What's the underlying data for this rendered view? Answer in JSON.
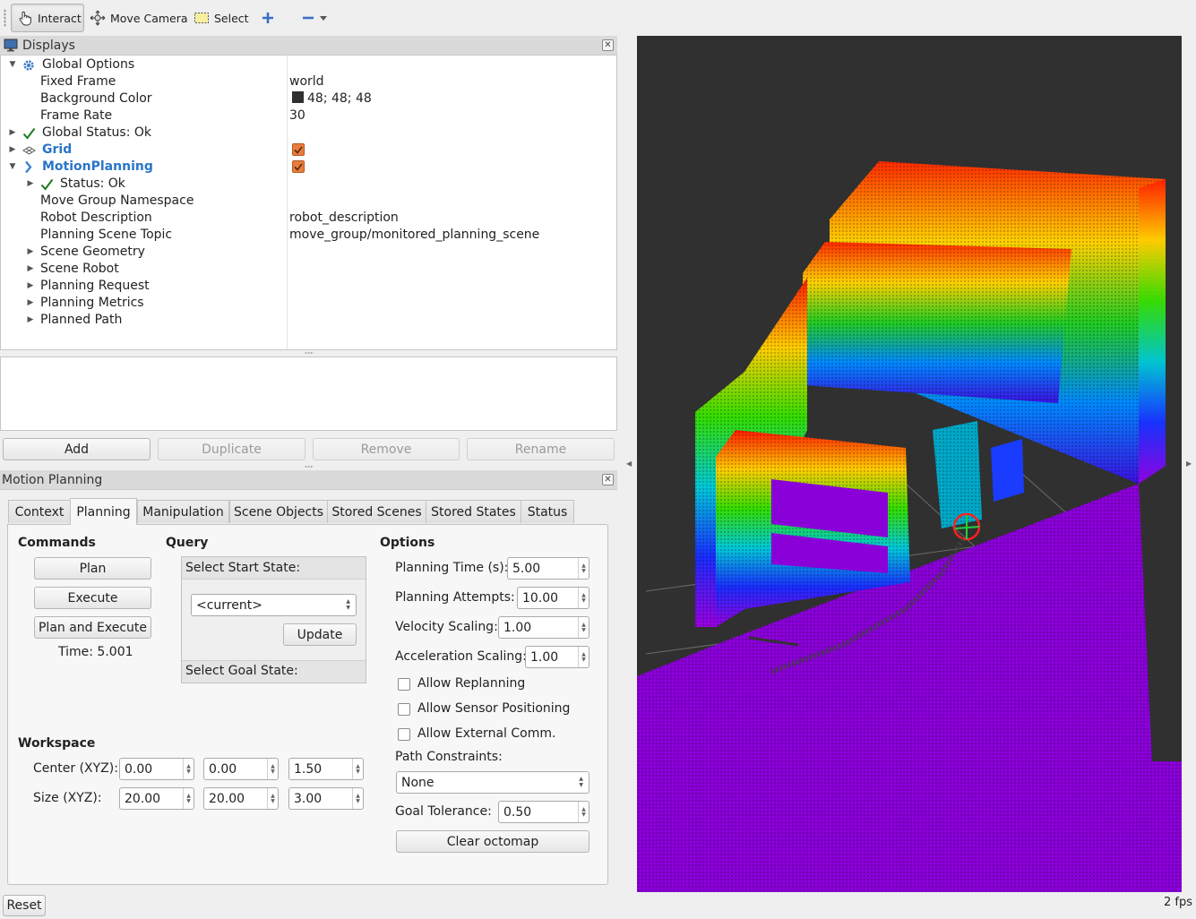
{
  "toolbar": {
    "interact": "Interact",
    "move_camera": "Move Camera",
    "select": "Select"
  },
  "displays_panel": {
    "title": "Displays",
    "rows": [
      {
        "label": "Global Options",
        "value": ""
      },
      {
        "label": "Fixed Frame",
        "value": "world"
      },
      {
        "label": "Background Color",
        "value": "48; 48; 48"
      },
      {
        "label": "Frame Rate",
        "value": "30"
      },
      {
        "label": "Global Status: Ok",
        "value": ""
      },
      {
        "label": "Grid",
        "value": ""
      },
      {
        "label": "MotionPlanning",
        "value": ""
      },
      {
        "label": "Status: Ok",
        "value": ""
      },
      {
        "label": "Move Group Namespace",
        "value": ""
      },
      {
        "label": "Robot Description",
        "value": "robot_description"
      },
      {
        "label": "Planning Scene Topic",
        "value": "move_group/monitored_planning_scene"
      },
      {
        "label": "Scene Geometry",
        "value": ""
      },
      {
        "label": "Scene Robot",
        "value": ""
      },
      {
        "label": "Planning Request",
        "value": ""
      },
      {
        "label": "Planning Metrics",
        "value": ""
      },
      {
        "label": "Planned Path",
        "value": ""
      }
    ],
    "background_color_hex": "#303030",
    "buttons": {
      "add": "Add",
      "duplicate": "Duplicate",
      "remove": "Remove",
      "rename": "Rename"
    }
  },
  "motion_planning": {
    "title": "Motion Planning",
    "tabs": [
      "Context",
      "Planning",
      "Manipulation",
      "Scene Objects",
      "Stored Scenes",
      "Stored States",
      "Status"
    ],
    "active_tab": "Planning",
    "commands": {
      "heading": "Commands",
      "plan": "Plan",
      "execute": "Execute",
      "plan_and_execute": "Plan and Execute",
      "time": "Time: 5.001"
    },
    "query": {
      "heading": "Query",
      "start_label": "Select Start State:",
      "start_value": "<current>",
      "update": "Update",
      "goal_label": "Select Goal State:"
    },
    "options": {
      "heading": "Options",
      "planning_time_label": "Planning Time (s):",
      "planning_time": "5.00",
      "planning_attempts_label": "Planning Attempts:",
      "planning_attempts": "10.00",
      "velocity_scaling_label": "Velocity Scaling:",
      "velocity_scaling": "1.00",
      "acceleration_scaling_label": "Acceleration Scaling:",
      "acceleration_scaling": "1.00",
      "allow_replanning": "Allow Replanning",
      "allow_sensor_positioning": "Allow Sensor Positioning",
      "allow_external_comm": "Allow External Comm.",
      "path_constraints_label": "Path Constraints:",
      "path_constraints": "None",
      "goal_tolerance_label": "Goal Tolerance:",
      "goal_tolerance": "0.50",
      "clear_octomap": "Clear octomap"
    },
    "workspace": {
      "heading": "Workspace",
      "center_label": "Center (XYZ):",
      "center": [
        "0.00",
        "0.00",
        "1.50"
      ],
      "size_label": "Size (XYZ):",
      "size": [
        "20.00",
        "20.00",
        "3.00"
      ]
    }
  },
  "statusbar": {
    "reset": "Reset",
    "fps": "2 fps"
  }
}
